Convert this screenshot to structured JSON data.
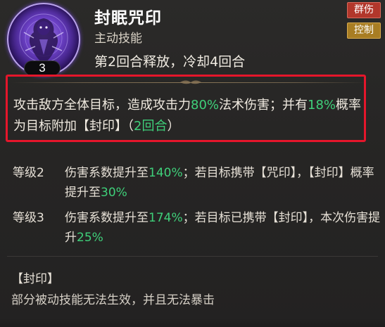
{
  "skill": {
    "name": "封眠咒印",
    "type": "主动技能",
    "cast_info": "第2回合释放，冷却4回合",
    "level": "3",
    "icon": "purple-curse-seal-icon",
    "tags": [
      "群伤",
      "控制"
    ]
  },
  "description": {
    "p1": "攻击敌方全体目标，造成攻击力",
    "v1": "80%",
    "p2": "法术伤害；并有",
    "v2": "18%",
    "p3": "概率为目标附加【封印】（",
    "v3": "2回合",
    "p4": "）"
  },
  "upgrades": [
    {
      "level": "等级2",
      "p1": "伤害系数提升至",
      "v1": "140%",
      "p2": "；若目标携带【咒印】，【封印】概率提升至",
      "v2": "30%"
    },
    {
      "level": "等级3",
      "p1": "伤害系数提升至",
      "v1": "174%",
      "p2": "；若目标已携带【封印】，本次伤害提升",
      "v2": "25%"
    }
  ],
  "note": {
    "title": "【封印】",
    "text": "部分被动技能无法生效，并且无法暴击"
  },
  "colors": {
    "highlight": "#3fd07a",
    "box_border": "#e5162b",
    "tag_red": "#b2372b",
    "tag_gold": "#a87d23"
  }
}
